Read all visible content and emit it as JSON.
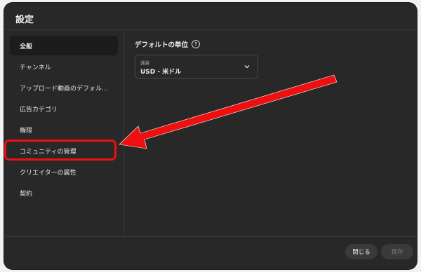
{
  "dialog": {
    "title": "設定"
  },
  "sidebar": {
    "items": [
      {
        "label": "全般",
        "active": true
      },
      {
        "label": "チャンネル"
      },
      {
        "label": "アップロード動画のデフォル…"
      },
      {
        "label": "広告カテゴリ"
      },
      {
        "label": "権限"
      },
      {
        "label": "コミュニティの管理"
      },
      {
        "label": "クリエイターの属性"
      },
      {
        "label": "契約"
      }
    ]
  },
  "main": {
    "section_title": "デフォルトの単位",
    "help_icon": "?",
    "currency_select": {
      "label": "通貨",
      "value": "USD - 米ドル"
    }
  },
  "footer": {
    "close_label": "閉じる",
    "save_label": "保存"
  },
  "annotation": {
    "color": "#ee1010"
  }
}
